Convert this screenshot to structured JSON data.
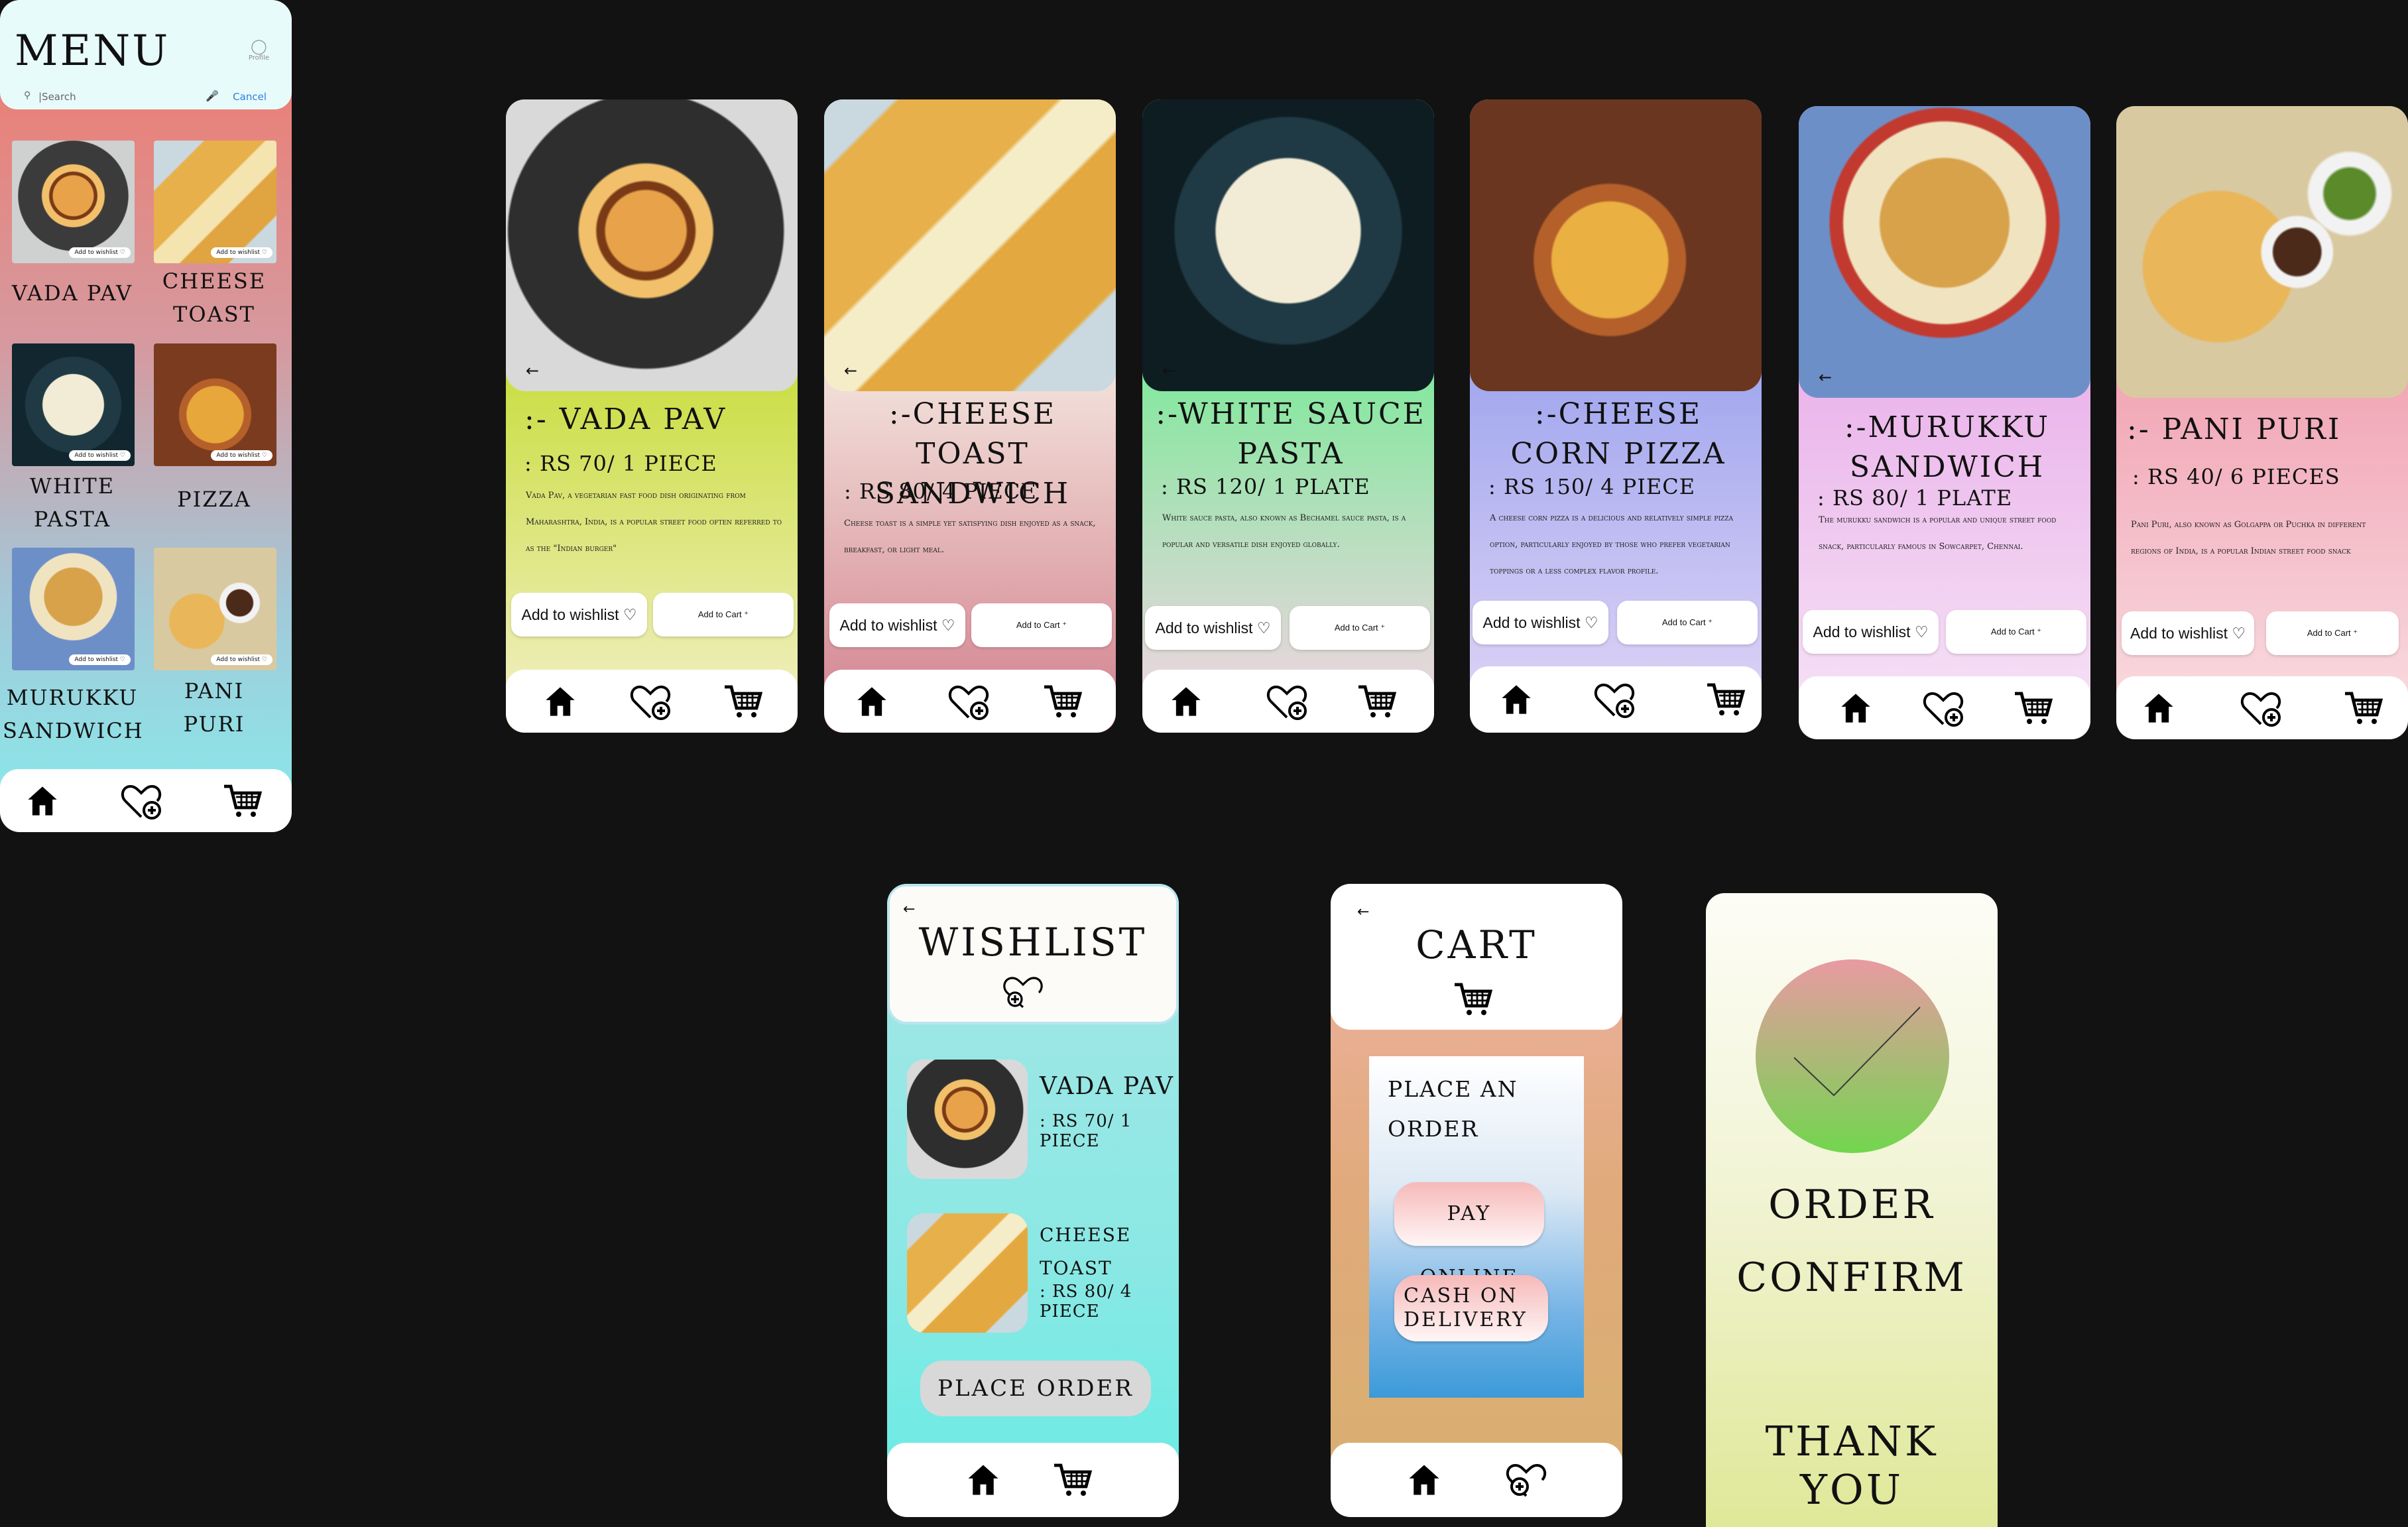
{
  "menu_screen": {
    "title": "MENU",
    "profile_label": "Profile",
    "search": {
      "placeholder": "|Search",
      "cancel": "Cancel"
    },
    "wishlist_badge": "Add to wishlist ♡",
    "items": [
      {
        "name": "VADA PAV",
        "line1": "VADA PAV",
        "line2": ""
      },
      {
        "name": "CHEESE TOAST",
        "line1": "CHEESE",
        "line2": "TOAST"
      },
      {
        "name": "WHITE PASTA",
        "line1": "WHITE",
        "line2": "PASTA"
      },
      {
        "name": "PIZZA",
        "line1": "PIZZA",
        "line2": ""
      },
      {
        "name": "MURUKKU SANDWICH",
        "line1": "MURUKKU",
        "line2": "SANDWICH"
      },
      {
        "name": "PANI PURI",
        "line1": "PANI",
        "line2": "PURI"
      }
    ]
  },
  "detail_screens": [
    {
      "title": ":- VADA PAV",
      "price": ": RS 70/ 1 PIECE",
      "description": "Vada Pav, a vegetarian fast food dish originating from Maharashtra, India, is a popular street food often referred to as the \"Indian burger\"",
      "gradient": [
        "#c8dd3c",
        "#f3f0c8"
      ]
    },
    {
      "title": ":-CHEESE TOAST SANDWICH",
      "price": ": RS 80/ 4 PIECE",
      "description": "Cheese toast is a simple yet satisfying dish enjoyed as a snack, breakfast, or light meal.",
      "gradient": [
        "#f1ded8",
        "#d27f8c"
      ]
    },
    {
      "title": ":-WHITE SAUCE PASTA",
      "price": ": RS 120/ 1 PLATE",
      "description": "White sauce pasta, also known as Bechamel sauce pasta, is a popular and versatile dish enjoyed globally.",
      "gradient": [
        "#7de99a",
        "#f7d3e6"
      ]
    },
    {
      "title": ":-CHEESE CORN PIZZA",
      "price": ": RS 150/ 4 PIECE",
      "description": "A cheese corn pizza is a delicious and relatively simple pizza option, particularly enjoyed by those who prefer vegetarian toppings or a less complex flavor profile.",
      "gradient": [
        "#9ea5ee",
        "#e2d6f6"
      ]
    },
    {
      "title": ":-MURUKKU SANDWICH",
      "price": ": RS 80/ 1 PLATE",
      "description": "The murukku sandwich is a popular and unique street food snack, particularly famous in Sowcarpet, Chennai.",
      "gradient": [
        "#eab2ea",
        "#f6e5f6"
      ]
    },
    {
      "title": ":- PANI PURI",
      "price": ": RS 40/ 6 PIECES",
      "description": "Pani Puri, also known as Golgappa or Puchka in different regions of India, is a popular Indian street food snack",
      "gradient": [
        "#f1a3b3",
        "#f9dfe3"
      ]
    }
  ],
  "buttons": {
    "wishlist": "Add to wishlist ♡",
    "cart": "Add to Cart ⁺"
  },
  "back_arrow": "←",
  "wishlist_screen": {
    "title": "WISHLIST",
    "items": [
      {
        "name": "VADA PAV",
        "name_line2": "",
        "price": ": RS 70/ 1 PIECE"
      },
      {
        "name": "CHEESE",
        "name_line2": "TOAST",
        "price": ": RS 80/ 4 PIECE"
      }
    ],
    "place_order": "PLACE ORDER"
  },
  "cart_screen": {
    "title": "CART",
    "panel_title_1": "PLACE AN",
    "panel_title_2": "ORDER",
    "pay_online": "PAY ONLINE",
    "cod_1": "CASH ON",
    "cod_2": "DELIVERY"
  },
  "confirm_screen": {
    "line1": "ORDER",
    "line2": "CONFIRM",
    "thanks": "THANK YOU"
  },
  "colors": {
    "background": "#121212",
    "cancel_link": "#2a7fe0",
    "check_circle_top": "#e99aa2",
    "check_circle_bottom": "#72d64e"
  }
}
